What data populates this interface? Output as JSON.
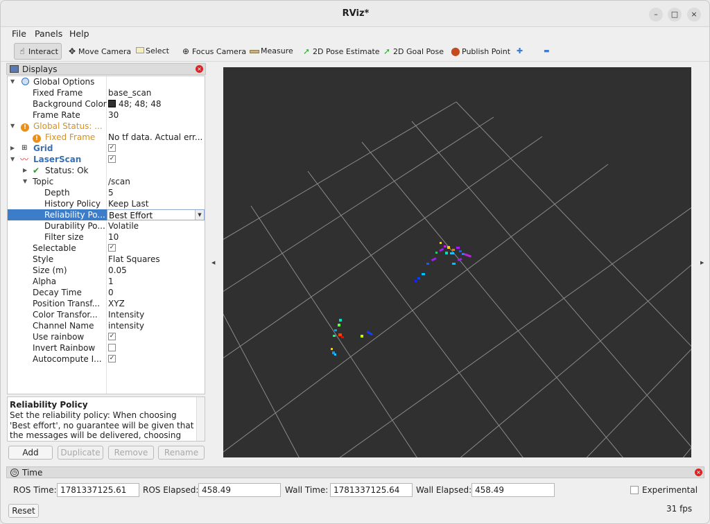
{
  "window": {
    "title": "RViz*",
    "min": "–",
    "max": "□",
    "close": "×"
  },
  "menu": [
    {
      "label": "File"
    },
    {
      "label": "Panels"
    },
    {
      "label": "Help"
    }
  ],
  "toolbar": {
    "interact": "Interact",
    "move_camera": "Move Camera",
    "select": "Select",
    "focus_camera": "Focus Camera",
    "measure": "Measure",
    "pose_estimate": "2D Pose Estimate",
    "goal_pose": "2D Goal Pose",
    "publish_point": "Publish Point",
    "plus": "✚",
    "minus": "▬"
  },
  "displays": {
    "title": "Displays",
    "rows": {
      "global_options": {
        "name": "Global Options"
      },
      "fixed_frame": {
        "name": "Fixed Frame",
        "value": "base_scan"
      },
      "background_color": {
        "name": "Background Color",
        "value": "48; 48; 48"
      },
      "frame_rate": {
        "name": "Frame Rate",
        "value": "30"
      },
      "global_status": {
        "name": "Global Status: ..."
      },
      "status_fixed_frame": {
        "name": "Fixed Frame",
        "value": "No tf data.  Actual err..."
      },
      "grid": {
        "name": "Grid"
      },
      "laserscan": {
        "name": "LaserScan"
      },
      "status_ok": {
        "name": "Status: Ok"
      },
      "topic": {
        "name": "Topic",
        "value": "/scan"
      },
      "depth": {
        "name": "Depth",
        "value": "5"
      },
      "history_policy": {
        "name": "History Policy",
        "value": "Keep Last"
      },
      "reliability": {
        "name": "Reliability Po...",
        "value": "Best Effort"
      },
      "durability": {
        "name": "Durability Po...",
        "value": "Volatile"
      },
      "filter_size": {
        "name": "Filter size",
        "value": "10"
      },
      "selectable": {
        "name": "Selectable"
      },
      "style": {
        "name": "Style",
        "value": "Flat Squares"
      },
      "size": {
        "name": "Size (m)",
        "value": "0.05"
      },
      "alpha": {
        "name": "Alpha",
        "value": "1"
      },
      "decay_time": {
        "name": "Decay Time",
        "value": "0"
      },
      "position_transform": {
        "name": "Position Transf...",
        "value": "XYZ"
      },
      "color_transform": {
        "name": "Color Transfor...",
        "value": "Intensity"
      },
      "channel_name": {
        "name": "Channel Name",
        "value": "intensity"
      },
      "use_rainbow": {
        "name": "Use rainbow"
      },
      "invert_rainbow": {
        "name": "Invert Rainbow"
      },
      "autocompute": {
        "name": "Autocompute I..."
      }
    },
    "checkmark": "✓",
    "bg_swatch_color": "#303030"
  },
  "help": {
    "title": "Reliability Policy",
    "body": "Set the reliability policy: When choosing 'Best effort', no guarantee will be given that the messages will be delivered, choosing"
  },
  "buttons": {
    "add": "Add",
    "duplicate": "Duplicate",
    "remove": "Remove",
    "rename": "Rename"
  },
  "time": {
    "title": "Time",
    "ros_time_label": "ROS Time:",
    "ros_time": "1781337125.61",
    "ros_elapsed_label": "ROS Elapsed:",
    "ros_elapsed": "458.49",
    "wall_time_label": "Wall Time:",
    "wall_time": "1781337125.64",
    "wall_elapsed_label": "Wall Elapsed:",
    "wall_elapsed": "458.49",
    "experimental": "Experimental",
    "reset": "Reset",
    "fps": "31 fps"
  },
  "colors": {
    "viewport_bg": "#303030",
    "selection": "#3d7cc9",
    "link_blue": "#3a6fb3",
    "warning": "#d8901a"
  }
}
